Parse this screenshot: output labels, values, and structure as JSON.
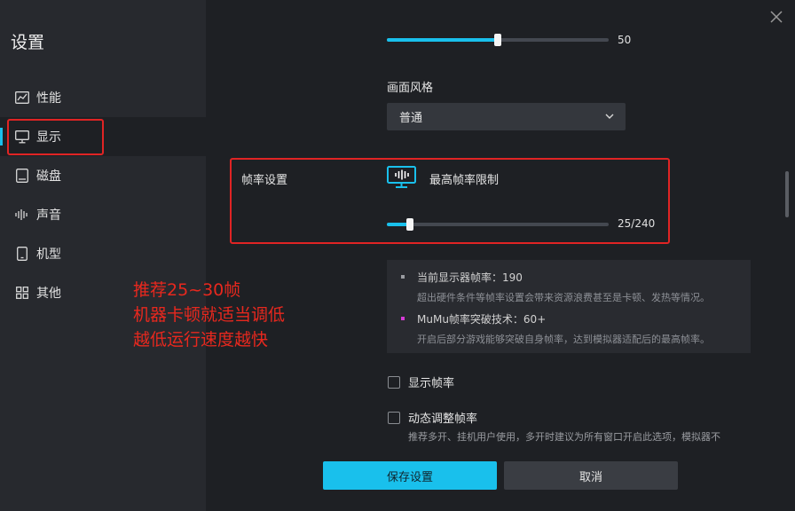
{
  "window": {
    "title": "设置"
  },
  "sidebar": {
    "items": [
      {
        "label": "性能",
        "icon": "performance-chart-icon"
      },
      {
        "label": "显示",
        "icon": "monitor-icon"
      },
      {
        "label": "磁盘",
        "icon": "disk-icon"
      },
      {
        "label": "声音",
        "icon": "sound-wave-icon"
      },
      {
        "label": "机型",
        "icon": "phone-icon"
      },
      {
        "label": "其他",
        "icon": "grid-icon"
      }
    ],
    "active": "显示"
  },
  "annotation": {
    "lines": [
      "推荐25~30帧",
      "机器卡顿就适当调低",
      "越低运行速度越快"
    ],
    "color": "#e8281e"
  },
  "top_slider": {
    "value": "50",
    "level": 0.5
  },
  "style": {
    "label": "画面风格",
    "selected": "普通"
  },
  "fps": {
    "section_label": "帧率设置",
    "limit_label": "最高帧率限制",
    "value_text": "25/240",
    "value": 25,
    "max": 240
  },
  "info": {
    "items": [
      {
        "title": "当前显示器帧率：190",
        "desc": "超出硬件条件等帧率设置会带来资源浪费甚至是卡顿、发热等情况。",
        "bullet_color": "#9a9ca1"
      },
      {
        "title": "MuMu帧率突破技术：60+",
        "desc": "开启后部分游戏能够突破自身帧率，达到模拟器适配后的最高帧率。",
        "bullet_color": "#d63bd6"
      }
    ]
  },
  "checkboxes": {
    "show_fps": {
      "label": "显示帧率",
      "checked": false
    },
    "dynamic_fps": {
      "label": "动态调整帧率",
      "checked": false,
      "desc": "推荐多开、挂机用户使用，多开时建议为所有窗口开启此选项，模拟器不"
    }
  },
  "buttons": {
    "save": "保存设置",
    "cancel": "取消"
  },
  "colors": {
    "accent": "#19c0ec",
    "background": "#1e2024",
    "sidebar": "#27292e",
    "highlight_box": "#e02424"
  }
}
